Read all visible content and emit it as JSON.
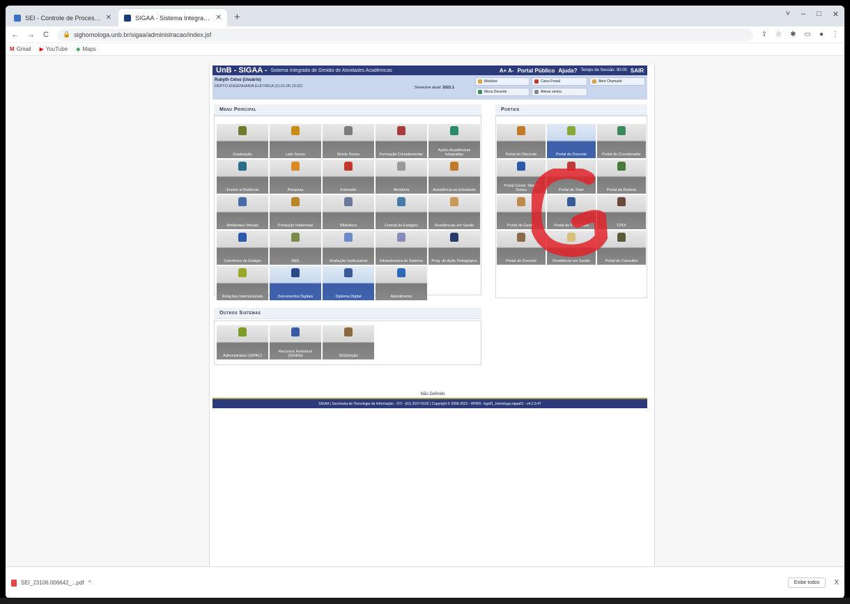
{
  "browser": {
    "tabs": [
      {
        "title": "SEI - Controle de Processos"
      },
      {
        "title": "SIGAA - Sistema Integrado de G"
      }
    ],
    "new_tab": "+",
    "window_controls": [
      "˅",
      "–",
      "□",
      "✕"
    ],
    "nav": {
      "back": "←",
      "forward": "→",
      "reload": "C"
    },
    "url": "sighomologa.unb.br/sigaa/administracao/index.jsf",
    "bookmarks": [
      "Gmail",
      "YouTube",
      "Maps"
    ],
    "download_file": "SEI_23106.006642_...pdf",
    "show_all": "Exibir todos",
    "close": "X"
  },
  "sigaa": {
    "header": {
      "logo": "UnB - SIGAA -",
      "subtitle": "Sistema Integrado de Gestão de Atividades Acadêmicas",
      "font_size": "A+ A-",
      "portal_publico": "Portal Público",
      "ajuda": "Ajuda?",
      "tempo_sessao": "Tempo de Sessão: 90:00",
      "sair": "SAIR"
    },
    "user": {
      "name": "Rubyth Celso (Usuário)",
      "dept": "DEPTO ENGENHARIA ELÉTRICA (11.01.05.13.02)",
      "semester_label": "Semestre atual:",
      "semester_value": "2022.1"
    },
    "toolbar": {
      "modulos": "Módulos",
      "caixa_postal": "Caixa Postal",
      "abrir_chamado": "Abrir Chamado",
      "menu_docente": "Menu Docente",
      "alterar_senha": "Alterar senha"
    },
    "menu_principal": {
      "title": "Menu Principal",
      "modules": [
        {
          "label": "Graduação",
          "color": "#6f7a2a"
        },
        {
          "label": "Lato Sensu",
          "color": "#c98c16"
        },
        {
          "label": "Stricto Sensu",
          "color": "#7d7d7d"
        },
        {
          "label": "Formação Complementar",
          "color": "#a83a3a"
        },
        {
          "label": "Ações Acadêmicas Integradas",
          "color": "#2a8a6a"
        },
        {
          "label": "Ensino a Distância",
          "color": "#2a6f8a"
        },
        {
          "label": "Pesquisa",
          "color": "#d98b2a"
        },
        {
          "label": "Extensão",
          "color": "#c0392b"
        },
        {
          "label": "Monitoria",
          "color": "#999999"
        },
        {
          "label": "Assistência ao Estudante",
          "color": "#c07a2a"
        },
        {
          "label": "Ambientes Virtuais",
          "color": "#4a6aa8"
        },
        {
          "label": "Produção Intelectual",
          "color": "#b8862a"
        },
        {
          "label": "Biblioteca",
          "color": "#6a7a9a"
        },
        {
          "label": "Central de Estágios",
          "color": "#4a7aa8"
        },
        {
          "label": "Residências em Saúde",
          "color": "#c89a5a"
        },
        {
          "label": "Convênios de Estágio",
          "color": "#2a5aa8"
        },
        {
          "label": "NEE",
          "color": "#7a8a4a"
        },
        {
          "label": "Avaliação Institucional",
          "color": "#6a8ac8"
        },
        {
          "label": "Infraestrutura de Sistema",
          "color": "#8a8ab8"
        },
        {
          "label": "Prog. de Ação Pedagógica",
          "color": "#2a3a6a"
        },
        {
          "label": "Relações Internacionais",
          "color": "#9aa82a"
        },
        {
          "label": "Documentos Digitais",
          "color": "#2a4a8a",
          "selected": true
        },
        {
          "label": "Diploma Digital",
          "color": "#3a5a9a",
          "selected": true
        },
        {
          "label": "Atendimento",
          "color": "#2a6ab8"
        }
      ]
    },
    "outros_sistemas": {
      "title": "Outros Sistemas",
      "items": [
        {
          "label": "Administrativo (SIPAC)",
          "color": "#7a9a2a"
        },
        {
          "label": "Recursos Humanos (SIGRH)",
          "color": "#3a5aa8"
        },
        {
          "label": "SIGEleição",
          "color": "#8a6a3a"
        }
      ]
    },
    "portais": {
      "title": "Portais",
      "items": [
        {
          "label": "Portal do Discente",
          "color": "#c07a2a"
        },
        {
          "label": "Portal do Docente",
          "color": "#8aa83a",
          "selected": true
        },
        {
          "label": "Portal do Coordenador",
          "color": "#3a8a5a"
        },
        {
          "label": "Portal Coord. Stricto Sensu",
          "color": "#2a5aa8"
        },
        {
          "label": "Portal do Tutor",
          "color": "#c03a3a"
        },
        {
          "label": "Portal da Reitoria",
          "color": "#4a7a3a"
        },
        {
          "label": "Portal do Gestor",
          "color": "#c08a4a"
        },
        {
          "label": "Portal de Protocolos",
          "color": "#3a5a9a"
        },
        {
          "label": "CPDI",
          "color": "#6a4a3a"
        },
        {
          "label": "Portal do Docente",
          "color": "#8a6a4a"
        },
        {
          "label": "Residência em Saúde",
          "color": "#d9c07a"
        },
        {
          "label": "Portal do Consultor",
          "color": "#5a5a3a"
        }
      ]
    },
    "nao_definido": "Não Definido",
    "footer": "SIGAA | Secretaria de Tecnologia da Informação - STI - (61) 3107-0102 | Copyright © 2006-2022 - HPRN - bgs01_homologa.sigaa01 - v4.2.9.47"
  },
  "annotation_color": "#e0232a"
}
